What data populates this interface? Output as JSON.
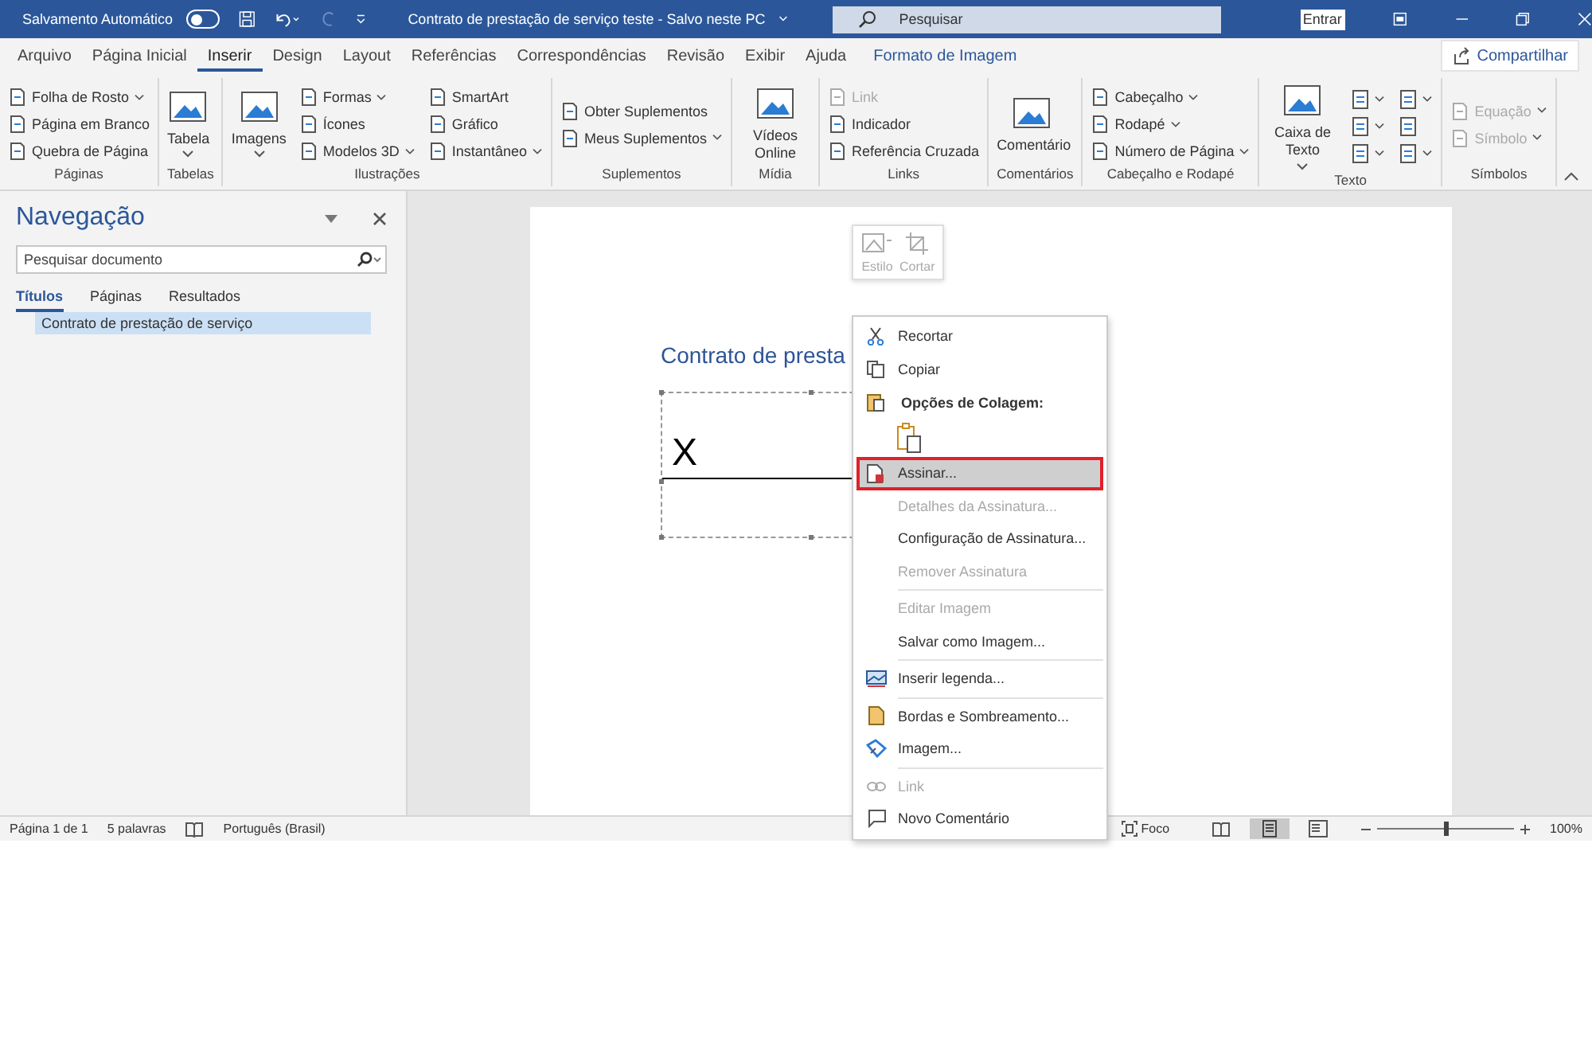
{
  "title_bar": {
    "autosave_label": "Salvamento Automático",
    "autosave_on": false,
    "document_title": "Contrato de prestação de serviço teste  -  Salvo neste PC",
    "search_placeholder": "Pesquisar",
    "sign_in_button": "Entrar"
  },
  "menu_tabs": [
    {
      "label": "Arquivo",
      "selected": false
    },
    {
      "label": "Página Inicial",
      "selected": false
    },
    {
      "label": "Inserir",
      "selected": true
    },
    {
      "label": "Design",
      "selected": false
    },
    {
      "label": "Layout",
      "selected": false
    },
    {
      "label": "Referências",
      "selected": false
    },
    {
      "label": "Correspondências",
      "selected": false
    },
    {
      "label": "Revisão",
      "selected": false
    },
    {
      "label": "Exibir",
      "selected": false
    },
    {
      "label": "Ajuda",
      "selected": false
    },
    {
      "label": "Formato de Imagem",
      "selected": false,
      "kind": "contextual"
    }
  ],
  "share_button": "Compartilhar",
  "ribbon_groups": [
    {
      "label": "Páginas",
      "columns": [
        [
          {
            "kind": "small",
            "label": "Folha de Rosto",
            "dropdown": true,
            "disabled": false
          },
          {
            "kind": "small",
            "label": "Página em Branco",
            "dropdown": false,
            "disabled": false
          },
          {
            "kind": "small",
            "label": "Quebra de Página",
            "dropdown": false,
            "disabled": false
          }
        ]
      ]
    },
    {
      "label": "Tabelas",
      "columns": [
        [
          {
            "kind": "large",
            "label": "Tabela",
            "dropdown": true,
            "disabled": false
          }
        ]
      ]
    },
    {
      "label": "Ilustrações",
      "columns": [
        [
          {
            "kind": "large",
            "label": "Imagens",
            "dropdown": true,
            "disabled": false
          }
        ],
        [
          {
            "kind": "small",
            "label": "Formas",
            "dropdown": true,
            "disabled": false
          },
          {
            "kind": "small",
            "label": "Ícones",
            "dropdown": false,
            "disabled": false
          },
          {
            "kind": "small",
            "label": "Modelos 3D",
            "dropdown": true,
            "disabled": false
          }
        ],
        [
          {
            "kind": "small",
            "label": "SmartArt",
            "dropdown": false,
            "disabled": false
          },
          {
            "kind": "small",
            "label": "Gráfico",
            "dropdown": false,
            "disabled": false
          },
          {
            "kind": "small",
            "label": "Instantâneo",
            "dropdown": true,
            "disabled": false
          }
        ]
      ]
    },
    {
      "label": "Suplementos",
      "columns": [
        [
          {
            "kind": "small",
            "label": "Obter Suplementos",
            "dropdown": false,
            "disabled": false
          },
          {
            "kind": "small",
            "label": "Meus Suplementos",
            "dropdown": true,
            "disabled": false
          }
        ]
      ]
    },
    {
      "label": "Mídia",
      "columns": [
        [
          {
            "kind": "large",
            "label": "Vídeos Online",
            "dropdown": false,
            "disabled": false
          }
        ]
      ]
    },
    {
      "label": "Links",
      "columns": [
        [
          {
            "kind": "small",
            "label": "Link",
            "dropdown": false,
            "disabled": true
          },
          {
            "kind": "small",
            "label": "Indicador",
            "dropdown": false,
            "disabled": false
          },
          {
            "kind": "small",
            "label": "Referência Cruzada",
            "dropdown": false,
            "disabled": false
          }
        ]
      ]
    },
    {
      "label": "Comentários",
      "columns": [
        [
          {
            "kind": "large",
            "label": "Comentário",
            "dropdown": false,
            "disabled": false
          }
        ]
      ]
    },
    {
      "label": "Cabeçalho e Rodapé",
      "columns": [
        [
          {
            "kind": "small",
            "label": "Cabeçalho",
            "dropdown": true,
            "disabled": false
          },
          {
            "kind": "small",
            "label": "Rodapé",
            "dropdown": true,
            "disabled": false
          },
          {
            "kind": "small",
            "label": "Número de Página",
            "dropdown": true,
            "disabled": false
          }
        ]
      ]
    },
    {
      "label": "Texto",
      "columns": [
        [
          {
            "kind": "large",
            "label": "Caixa de Texto",
            "dropdown": true,
            "disabled": false
          }
        ],
        [
          {
            "kind": "icon",
            "dropdown": true,
            "disabled": false
          },
          {
            "kind": "icon",
            "dropdown": true,
            "disabled": false
          },
          {
            "kind": "icon",
            "dropdown": true,
            "disabled": false
          }
        ],
        [
          {
            "kind": "icon",
            "dropdown": true,
            "disabled": false
          },
          {
            "kind": "icon",
            "dropdown": false,
            "disabled": false
          },
          {
            "kind": "icon",
            "dropdown": true,
            "disabled": false
          }
        ]
      ]
    },
    {
      "label": "Símbolos",
      "columns": [
        [
          {
            "kind": "small",
            "label": "Equação",
            "dropdown": true,
            "disabled": true
          },
          {
            "kind": "small",
            "label": "Símbolo",
            "dropdown": true,
            "disabled": true
          }
        ]
      ]
    }
  ],
  "navigation": {
    "title": "Navegação",
    "search_placeholder": "Pesquisar documento",
    "tabs": [
      {
        "label": "Títulos",
        "selected": true
      },
      {
        "label": "Páginas",
        "selected": false
      },
      {
        "label": "Resultados",
        "selected": false
      }
    ],
    "headings": [
      {
        "label": "Contrato de prestação de serviço",
        "selected": true
      }
    ]
  },
  "document": {
    "heading": "Contrato de presta",
    "signature_mark": "X",
    "mini_toolbar": [
      {
        "label": "Estilo",
        "disabled": true
      },
      {
        "label": "Cortar",
        "disabled": true
      }
    ]
  },
  "context_menu": [
    {
      "kind": "item",
      "label": "Recortar",
      "disabled": false,
      "selected": false
    },
    {
      "kind": "item",
      "label": "Copiar",
      "disabled": false,
      "selected": false
    },
    {
      "kind": "heading",
      "label": "Opções de Colagem:"
    },
    {
      "kind": "paste_options"
    },
    {
      "kind": "item",
      "label": "Assinar...",
      "disabled": false,
      "selected": true
    },
    {
      "kind": "item",
      "label": "Detalhes da Assinatura...",
      "disabled": true,
      "selected": false
    },
    {
      "kind": "item",
      "label": "Configuração de Assinatura...",
      "disabled": false,
      "selected": false
    },
    {
      "kind": "item",
      "label": "Remover Assinatura",
      "disabled": true,
      "selected": false
    },
    {
      "kind": "separator"
    },
    {
      "kind": "item",
      "label": "Editar Imagem",
      "disabled": true,
      "selected": false
    },
    {
      "kind": "item",
      "label": "Salvar como Imagem...",
      "disabled": false,
      "selected": false
    },
    {
      "kind": "separator"
    },
    {
      "kind": "item",
      "label": "Inserir legenda...",
      "disabled": false,
      "selected": false
    },
    {
      "kind": "separator"
    },
    {
      "kind": "item",
      "label": "Bordas e Sombreamento...",
      "disabled": false,
      "selected": false
    },
    {
      "kind": "item",
      "label": "Imagem...",
      "disabled": false,
      "selected": false
    },
    {
      "kind": "separator"
    },
    {
      "kind": "item",
      "label": "Link",
      "disabled": true,
      "selected": false
    },
    {
      "kind": "item",
      "label": "Novo Comentário",
      "disabled": false,
      "selected": false
    }
  ],
  "status_bar": {
    "page": "Página 1 de 1",
    "words": "5 palavras",
    "language": "Português (Brasil)",
    "focus": "Foco",
    "zoom_slider": {
      "level": 0.5
    },
    "zoom": "100%"
  }
}
